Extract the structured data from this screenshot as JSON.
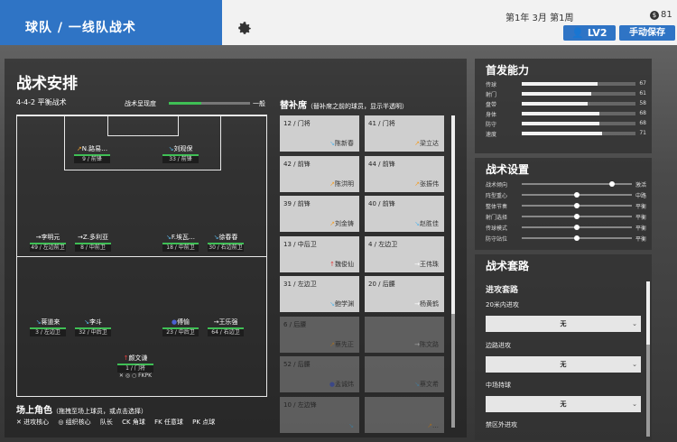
{
  "header": {
    "title": "球队 / 一线队战术",
    "date": "第1年 3月 第1周",
    "money_symbol": "$",
    "money": "81",
    "level_label": "LV2",
    "manual_save_label": "手动保存"
  },
  "tactics": {
    "title": "战术安排",
    "formation": "4-4-2 平衡战术",
    "visibility_label": "战术呈现度",
    "visibility_value_label": "一般"
  },
  "players": [
    {
      "name": "N.路易…",
      "num": "9 / 前锋"
    },
    {
      "name": "刘观保",
      "num": "33 / 前锋"
    },
    {
      "name": "李明元",
      "num": "49 / 左边前卫"
    },
    {
      "name": "Z.多利亚",
      "num": "8 / 中前卫"
    },
    {
      "name": "F.埃瓦…",
      "num": "18 / 中前卫"
    },
    {
      "name": "徐春春",
      "num": "30 / 右边前卫"
    },
    {
      "name": "蒋道来",
      "num": "3 / 左边卫"
    },
    {
      "name": "李斗",
      "num": "32 / 中后卫"
    },
    {
      "name": "傅愉",
      "num": "23 / 中后卫"
    },
    {
      "name": "王乐强",
      "num": "64 / 右边卫"
    },
    {
      "name": "颜文谦",
      "num": "1 / 门将"
    }
  ],
  "gk_extra": "✕ ◎ ○ FKPK",
  "subs": {
    "title": "替补席",
    "hint": "（替补席之前的球员，显示半透明）",
    "items": [
      {
        "pos": "12 / 门将",
        "name": "陈新春"
      },
      {
        "pos": "41 / 门将",
        "name": "梁立达"
      },
      {
        "pos": "42 / 前锋",
        "name": "陈洪明"
      },
      {
        "pos": "44 / 前锋",
        "name": "张振伟"
      },
      {
        "pos": "39 / 前锋",
        "name": "刘金铸"
      },
      {
        "pos": "40 / 前锋",
        "name": "赵胜佳"
      },
      {
        "pos": "13 / 中后卫",
        "name": "魏俊仙"
      },
      {
        "pos": "4 / 左边卫",
        "name": "王伟珠"
      },
      {
        "pos": "31 / 左边卫",
        "name": "鲍学渊"
      },
      {
        "pos": "20 / 后腰",
        "name": "杨黄鹤"
      },
      {
        "pos": "6 / 后腰",
        "name": "蔡先正"
      },
      {
        "pos": "",
        "name": "陈文路"
      },
      {
        "pos": "52 / 后腰",
        "name": "孟诚炜"
      },
      {
        "pos": "",
        "name": "蔡文希"
      },
      {
        "pos": "10 / 左边锋",
        "name": ""
      },
      {
        "pos": "",
        "name": "…"
      }
    ]
  },
  "field_roles": {
    "title": "场上角色",
    "hint": "（拖拽至场上球员，或点击选择）",
    "items": [
      "✕ 进攻核心",
      "◎ 组织核心",
      "队长",
      "CK 角球",
      "FK 任意球",
      "PK 点球"
    ]
  },
  "abilities": {
    "title": "首发能力",
    "rows": [
      {
        "label": "传球",
        "value": 67
      },
      {
        "label": "射门",
        "value": 61
      },
      {
        "label": "盘带",
        "value": 58
      },
      {
        "label": "身体",
        "value": 68
      },
      {
        "label": "防守",
        "value": 68
      },
      {
        "label": "速度",
        "value": 71
      }
    ]
  },
  "settings": {
    "title": "战术设置",
    "rows": [
      {
        "label": "战术倾向",
        "value": "激活",
        "level": 0.82
      },
      {
        "label": "阵型重心",
        "value": "中路",
        "level": 0.5
      },
      {
        "label": "整体节奏",
        "value": "平衡",
        "level": 0.5
      },
      {
        "label": "射门选择",
        "value": "平衡",
        "level": 0.5
      },
      {
        "label": "传球模式",
        "value": "平衡",
        "level": 0.5
      },
      {
        "label": "防守站位",
        "value": "平衡",
        "level": 0.5
      }
    ]
  },
  "routes": {
    "title": "战术套路",
    "attack_title": "进攻套路",
    "groups": [
      {
        "label": "20米内进攻",
        "value": "无"
      },
      {
        "label": "边路进攻",
        "value": "无"
      },
      {
        "label": "中场持球",
        "value": "无"
      },
      {
        "label": "禁区外进攻",
        "value": ""
      }
    ]
  }
}
